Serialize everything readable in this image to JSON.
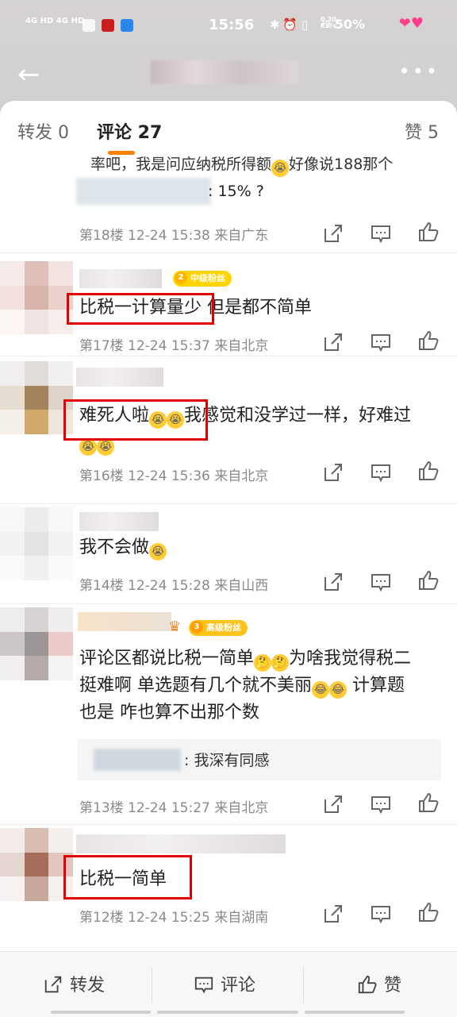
{
  "status": {
    "time": "15:56",
    "signal": "4G HD 4G HD",
    "speed_top": "0.30",
    "speed_bottom": "KB/s",
    "battery": "50%"
  },
  "tabs": {
    "repost": "转发 0",
    "comments": "评论 27",
    "likes": "赞 5"
  },
  "partial_comment": {
    "text_line1": "率吧，我是问应纳税所得额",
    "text_line1_tail": "好像说188那个",
    "text_line2": ": 15% ?",
    "meta": "第18楼  12-24 15:38  来自广东"
  },
  "comments": [
    {
      "badge": "中级粉丝",
      "badge_num": "2",
      "text": "比税一计算量少 但是都不简单",
      "meta": "第17楼  12-24 15:37  来自北京"
    },
    {
      "text_a": "难死人啦",
      "text_b": "我感觉和没学过一样，好难过",
      "meta": "第16楼  12-24 15:36  来自北京"
    },
    {
      "text": "我不会做",
      "meta": "第14楼  12-24 15:28  来自山西"
    },
    {
      "badge": "高级粉丝",
      "badge_num": "3",
      "text_a": "评论区都说比税一简单",
      "text_b": "为啥我觉得税二",
      "text_c": "挺难啊 单选题有几个就不美丽",
      "text_d": " 计算题",
      "text_e": "也是 咋也算不出那个数",
      "reply": ": 我深有同感",
      "meta": "第13楼  12-24 15:27  来自北京"
    },
    {
      "text": "比税一简单",
      "meta": "第12楼  12-24 15:25  来自湖南"
    }
  ],
  "bottom": {
    "repost": "转发",
    "comment": "评论",
    "like": "赞"
  },
  "icons": {
    "back": "back-arrow-icon",
    "more": "more-dots-icon",
    "share": "share-icon",
    "comment": "comment-icon",
    "like": "like-icon"
  },
  "colors": {
    "accent": "#ff8200",
    "highlight_box": "#e00000",
    "badge": "#ffd400"
  }
}
